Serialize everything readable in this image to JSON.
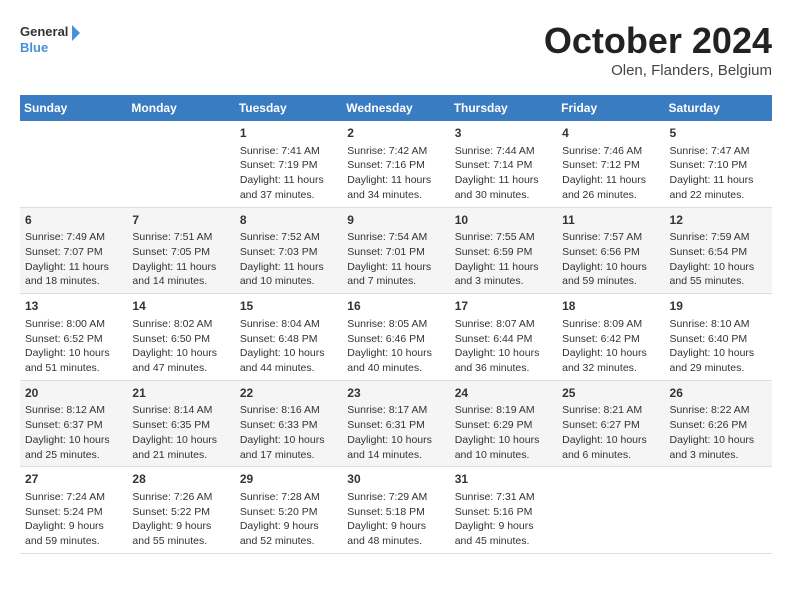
{
  "header": {
    "logo": {
      "line1": "General",
      "line2": "Blue"
    },
    "title": "October 2024",
    "location": "Olen, Flanders, Belgium"
  },
  "weekdays": [
    "Sunday",
    "Monday",
    "Tuesday",
    "Wednesday",
    "Thursday",
    "Friday",
    "Saturday"
  ],
  "weeks": [
    [
      {
        "day": "",
        "info": ""
      },
      {
        "day": "",
        "info": ""
      },
      {
        "day": "1",
        "info": "Sunrise: 7:41 AM\nSunset: 7:19 PM\nDaylight: 11 hours and 37 minutes."
      },
      {
        "day": "2",
        "info": "Sunrise: 7:42 AM\nSunset: 7:16 PM\nDaylight: 11 hours and 34 minutes."
      },
      {
        "day": "3",
        "info": "Sunrise: 7:44 AM\nSunset: 7:14 PM\nDaylight: 11 hours and 30 minutes."
      },
      {
        "day": "4",
        "info": "Sunrise: 7:46 AM\nSunset: 7:12 PM\nDaylight: 11 hours and 26 minutes."
      },
      {
        "day": "5",
        "info": "Sunrise: 7:47 AM\nSunset: 7:10 PM\nDaylight: 11 hours and 22 minutes."
      }
    ],
    [
      {
        "day": "6",
        "info": "Sunrise: 7:49 AM\nSunset: 7:07 PM\nDaylight: 11 hours and 18 minutes."
      },
      {
        "day": "7",
        "info": "Sunrise: 7:51 AM\nSunset: 7:05 PM\nDaylight: 11 hours and 14 minutes."
      },
      {
        "day": "8",
        "info": "Sunrise: 7:52 AM\nSunset: 7:03 PM\nDaylight: 11 hours and 10 minutes."
      },
      {
        "day": "9",
        "info": "Sunrise: 7:54 AM\nSunset: 7:01 PM\nDaylight: 11 hours and 7 minutes."
      },
      {
        "day": "10",
        "info": "Sunrise: 7:55 AM\nSunset: 6:59 PM\nDaylight: 11 hours and 3 minutes."
      },
      {
        "day": "11",
        "info": "Sunrise: 7:57 AM\nSunset: 6:56 PM\nDaylight: 10 hours and 59 minutes."
      },
      {
        "day": "12",
        "info": "Sunrise: 7:59 AM\nSunset: 6:54 PM\nDaylight: 10 hours and 55 minutes."
      }
    ],
    [
      {
        "day": "13",
        "info": "Sunrise: 8:00 AM\nSunset: 6:52 PM\nDaylight: 10 hours and 51 minutes."
      },
      {
        "day": "14",
        "info": "Sunrise: 8:02 AM\nSunset: 6:50 PM\nDaylight: 10 hours and 47 minutes."
      },
      {
        "day": "15",
        "info": "Sunrise: 8:04 AM\nSunset: 6:48 PM\nDaylight: 10 hours and 44 minutes."
      },
      {
        "day": "16",
        "info": "Sunrise: 8:05 AM\nSunset: 6:46 PM\nDaylight: 10 hours and 40 minutes."
      },
      {
        "day": "17",
        "info": "Sunrise: 8:07 AM\nSunset: 6:44 PM\nDaylight: 10 hours and 36 minutes."
      },
      {
        "day": "18",
        "info": "Sunrise: 8:09 AM\nSunset: 6:42 PM\nDaylight: 10 hours and 32 minutes."
      },
      {
        "day": "19",
        "info": "Sunrise: 8:10 AM\nSunset: 6:40 PM\nDaylight: 10 hours and 29 minutes."
      }
    ],
    [
      {
        "day": "20",
        "info": "Sunrise: 8:12 AM\nSunset: 6:37 PM\nDaylight: 10 hours and 25 minutes."
      },
      {
        "day": "21",
        "info": "Sunrise: 8:14 AM\nSunset: 6:35 PM\nDaylight: 10 hours and 21 minutes."
      },
      {
        "day": "22",
        "info": "Sunrise: 8:16 AM\nSunset: 6:33 PM\nDaylight: 10 hours and 17 minutes."
      },
      {
        "day": "23",
        "info": "Sunrise: 8:17 AM\nSunset: 6:31 PM\nDaylight: 10 hours and 14 minutes."
      },
      {
        "day": "24",
        "info": "Sunrise: 8:19 AM\nSunset: 6:29 PM\nDaylight: 10 hours and 10 minutes."
      },
      {
        "day": "25",
        "info": "Sunrise: 8:21 AM\nSunset: 6:27 PM\nDaylight: 10 hours and 6 minutes."
      },
      {
        "day": "26",
        "info": "Sunrise: 8:22 AM\nSunset: 6:26 PM\nDaylight: 10 hours and 3 minutes."
      }
    ],
    [
      {
        "day": "27",
        "info": "Sunrise: 7:24 AM\nSunset: 5:24 PM\nDaylight: 9 hours and 59 minutes."
      },
      {
        "day": "28",
        "info": "Sunrise: 7:26 AM\nSunset: 5:22 PM\nDaylight: 9 hours and 55 minutes."
      },
      {
        "day": "29",
        "info": "Sunrise: 7:28 AM\nSunset: 5:20 PM\nDaylight: 9 hours and 52 minutes."
      },
      {
        "day": "30",
        "info": "Sunrise: 7:29 AM\nSunset: 5:18 PM\nDaylight: 9 hours and 48 minutes."
      },
      {
        "day": "31",
        "info": "Sunrise: 7:31 AM\nSunset: 5:16 PM\nDaylight: 9 hours and 45 minutes."
      },
      {
        "day": "",
        "info": ""
      },
      {
        "day": "",
        "info": ""
      }
    ]
  ]
}
